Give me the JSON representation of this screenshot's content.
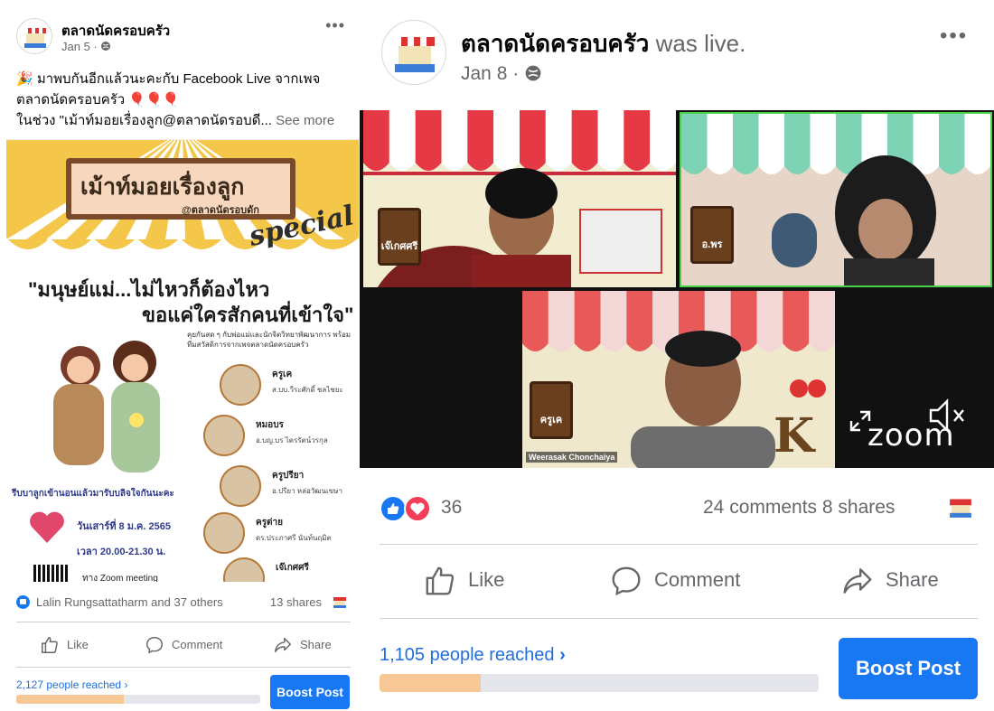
{
  "colors": {
    "facebook_blue": "#1877f2",
    "link_blue": "#216fdb",
    "muted": "#65676b",
    "reach_fill": "#f7c796",
    "live_border": "#4bd14b"
  },
  "left_post": {
    "page_name": "ตลาดนัดครอบครัว",
    "date": "Jan 5 ·",
    "more_icon": "ellipsis-icon",
    "text_line1": "🎉 มาพบกันอีกแล้วนะคะกับ Facebook Live จากเพจ",
    "text_line2": "ตลาดนัดครอบครัว 🎈🎈🎈",
    "text_line3": "ในช่วง \"เม้าท์มอยเรื่องลูก@ตลาดนัดรอบดี...",
    "see_more": "See more",
    "poster": {
      "title": "เม้าท์มอยเรื่องลูก",
      "subtitle": "@ตลาดนัดรอบดัก",
      "special": "special",
      "headline1": "\"มนุษย์แม่...ไม่ไหวก็ต้องไหว",
      "headline2": "ขอแค่ใครสักคนที่เข้าใจ\"",
      "intro": "คุยกันสด ๆ กับพ่อแม่และนักจิตวิทยาพัฒนาการ พร้อมทีมสวัสดิการจากเพจตลาดนัดครอบครัว",
      "bottom_line": "รีบบาลูกเข้านอนแล้วมารับบลิจใจกันนะคะ",
      "date_line": "วันเสาร์ที่ 8 ม.ค. 2565",
      "time_line": "เวลา 20.00-21.30 น.",
      "zoom_line": "ทาง Zoom meeting",
      "speakers": [
        {
          "name": "ครูเค",
          "desc": "ส.บบ.วีระศักดิ์ ชลไชยะ"
        },
        {
          "name": "หมอบร",
          "desc": "อ.บญ.บร ไตรรัตน์วรกุล"
        },
        {
          "name": "ครูปรียา",
          "desc": "อ.ปรียา หล่อวัฒนเขษา"
        },
        {
          "name": "ครูต่าย",
          "desc": "ดร.ประภาศรี นันท์นฤมิต"
        },
        {
          "name": "เจ๊เกศศรี",
          "desc": ""
        }
      ]
    },
    "stats": {
      "reactors": "Lalin Rungsattatharm and 37 others",
      "shares": "13 shares"
    },
    "actions": {
      "like": "Like",
      "comment": "Comment",
      "share": "Share"
    },
    "reach": {
      "label": "2,127 people reached",
      "progress_fraction": 0.44
    },
    "boost_label": "Boost Post"
  },
  "right_post": {
    "page_name": "ตลาดนัดครอบครัว",
    "was_live": "was live.",
    "date": "Jan 8 ·",
    "video": {
      "tile1_plate": "เจ๊เกศศรี",
      "tile2_plate": "อ.พร",
      "tile3_plate": "ครูเค",
      "tile3_label": "Weerasak Chonchaiya",
      "zoom_brand": "zoom"
    },
    "stats": {
      "reaction_count": "36",
      "comments_shares": "24 comments 8 shares"
    },
    "actions": {
      "like": "Like",
      "comment": "Comment",
      "share": "Share"
    },
    "reach": {
      "label": "1,105 people reached",
      "progress_fraction": 0.23
    },
    "boost_label": "Boost Post"
  }
}
